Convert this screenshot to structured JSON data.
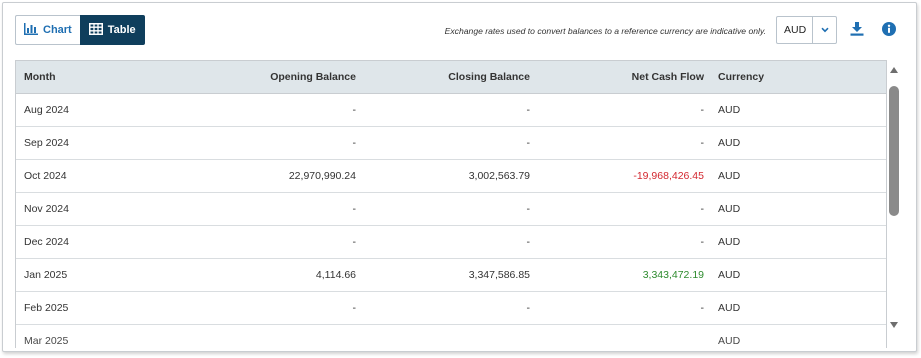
{
  "toolbar": {
    "chart_label": "Chart",
    "table_label": "Table",
    "disclaimer": "Exchange rates used to convert balances to a reference currency are indicative only.",
    "currency": "AUD"
  },
  "colors": {
    "active_toggle": "#0f3e5c",
    "link_blue": "#1f6fb2",
    "negative": "#d3272f",
    "positive": "#2e8b2e",
    "header_bg": "#dfe6ea"
  },
  "icons": [
    "bar-chart-icon",
    "table-grid-icon",
    "chevron-down-icon",
    "download-icon",
    "info-icon",
    "scroll-up-arrow-icon",
    "scroll-down-arrow-icon"
  ],
  "table": {
    "headers": {
      "month": "Month",
      "opening": "Opening Balance",
      "closing": "Closing Balance",
      "net": "Net Cash Flow",
      "currency": "Currency"
    },
    "rows": [
      {
        "month": "Aug 2024",
        "opening": "-",
        "closing": "-",
        "net": "-",
        "currency": "AUD",
        "net_status": "none"
      },
      {
        "month": "Sep 2024",
        "opening": "-",
        "closing": "-",
        "net": "-",
        "currency": "AUD",
        "net_status": "none"
      },
      {
        "month": "Oct 2024",
        "opening": "22,970,990.24",
        "closing": "3,002,563.79",
        "net": "-19,968,426.45",
        "currency": "AUD",
        "net_status": "negative"
      },
      {
        "month": "Nov 2024",
        "opening": "-",
        "closing": "-",
        "net": "-",
        "currency": "AUD",
        "net_status": "none"
      },
      {
        "month": "Dec 2024",
        "opening": "-",
        "closing": "-",
        "net": "-",
        "currency": "AUD",
        "net_status": "none"
      },
      {
        "month": "Jan 2025",
        "opening": "4,114.66",
        "closing": "3,347,586.85",
        "net": "3,343,472.19",
        "currency": "AUD",
        "net_status": "positive"
      },
      {
        "month": "Feb 2025",
        "opening": "-",
        "closing": "-",
        "net": "-",
        "currency": "AUD",
        "net_status": "none"
      },
      {
        "month": "Mar 2025",
        "opening": "",
        "closing": "",
        "net": "",
        "currency": "AUD",
        "net_status": "none"
      }
    ]
  }
}
